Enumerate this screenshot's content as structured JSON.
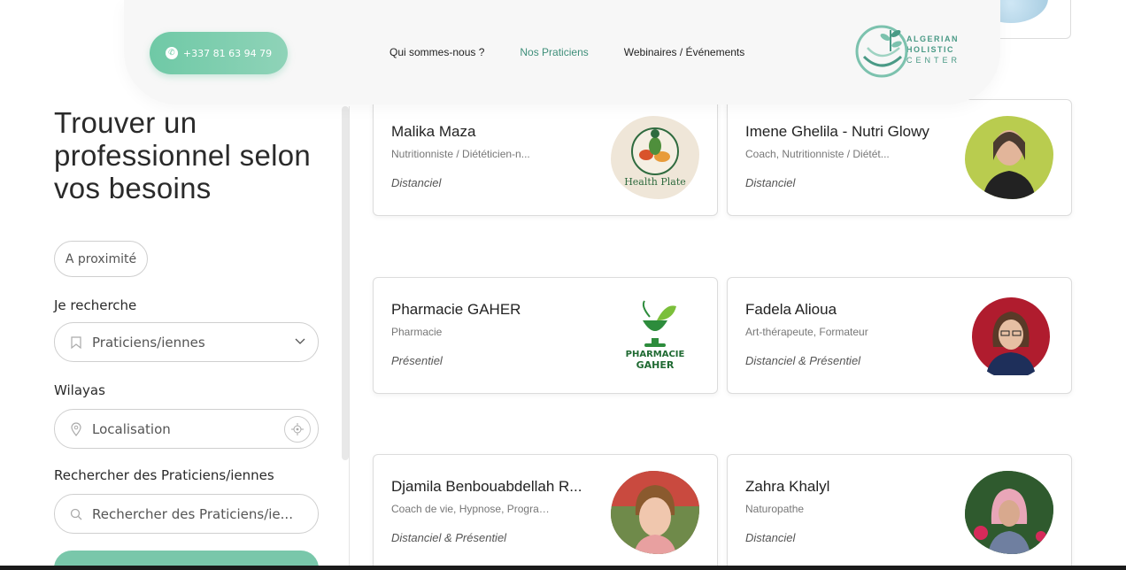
{
  "header": {
    "phone": "+337 81 63 94 79",
    "nav": [
      "Qui sommes-nous ?",
      "Nos Praticiens",
      "Webinaires / Événements"
    ],
    "active_nav": "Nos Praticiens",
    "logo_lines": [
      "ALGERIAN",
      "HOLISTIC",
      "CENTER"
    ]
  },
  "filters": {
    "title": "Trouver un professionnel selon vos besoins",
    "proximity_label": "A proximité",
    "search_type_label": "Je recherche",
    "search_type_value": "Praticiens/iennes",
    "wilaya_label": "Wilayas",
    "wilaya_placeholder": "Localisation",
    "keyword_label": "Rechercher des Praticiens/iennes",
    "keyword_placeholder": "Rechercher des Praticiens/ie..."
  },
  "cards": [
    {
      "name": "Malika Maza",
      "profession": "Nutritionniste / Diététicien-n...",
      "mode": "Distanciel",
      "avatar": "health-plate-logo"
    },
    {
      "name": "Imene Ghelila - Nutri Glowy",
      "profession": "Coach, Nutritionniste / Diétét...",
      "mode": "Distanciel",
      "avatar": "woman-photo"
    },
    {
      "name": "Pharmacie GAHER",
      "profession": "Pharmacie",
      "mode": "Présentiel",
      "avatar": "pharmacie-gaher-logo"
    },
    {
      "name": "Fadela Alioua",
      "profession": "Art-thérapeute, Formateur",
      "mode": "Distanciel & Présentiel",
      "avatar": "woman-photo"
    },
    {
      "name": "Djamila Benbouabdellah R...",
      "profession": "Coach de vie, Hypnose, Program...",
      "mode": "Distanciel & Présentiel",
      "avatar": "woman-photo"
    },
    {
      "name": "Zahra Khalyl",
      "profession": "Naturopathe",
      "mode": "Distanciel",
      "avatar": "woman-photo"
    }
  ],
  "logos": {
    "health_plate": "Health Plate",
    "pharmacie": [
      "PHARMACIE",
      "GAHER"
    ]
  },
  "colors": {
    "accent": "#6fc9a6",
    "nav_active": "#3f8f7a"
  }
}
